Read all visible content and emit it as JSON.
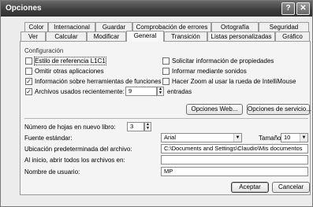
{
  "window": {
    "title": "Opciones",
    "help_label": "?",
    "close_label": "✕"
  },
  "tabs_row1": [
    "Color",
    "Internacional",
    "Guardar",
    "Comprobación de errores",
    "Ortografía",
    "Seguridad"
  ],
  "tabs_row2": [
    "Ver",
    "Calcular",
    "Modificar",
    "General",
    "Transición",
    "Listas personalizadas",
    "Gráfico"
  ],
  "active_tab": "General",
  "config": {
    "group_label": "Configuración",
    "left_options": [
      {
        "label": "Estilo de referencia L1C1",
        "checked": false
      },
      {
        "label": "Omitir otras aplicaciones",
        "checked": false
      },
      {
        "label": "Información sobre herramientas de funciones",
        "checked": true
      },
      {
        "label": "Archivos usados recientemente:",
        "checked": true
      }
    ],
    "right_options": [
      {
        "label": "Solicitar información de propiedades",
        "checked": false
      },
      {
        "label": "Informar mediante sonidos",
        "checked": false
      },
      {
        "label": "Hacer Zoom al usar la rueda de IntelliMouse",
        "checked": false
      }
    ],
    "recent_files_value": "9",
    "recent_files_suffix": "entradas",
    "web_options_button": "Opciones Web...",
    "service_options_button": "Opciones de servicio..."
  },
  "book": {
    "sheets_label": "Número de hojas en nuevo libro:",
    "sheets_value": "3",
    "font_label": "Fuente estándar:",
    "font_value": "Arial",
    "size_label": "Tamaño:",
    "size_value": "10",
    "default_location_label": "Ubicación predeterminada del archivo:",
    "default_location_value": "C:\\Documents and Settings\\Claudio\\Mis documentos",
    "startup_label": "Al inicio, abrir todos los archivos en:",
    "startup_value": "",
    "username_label": "Nombre de usuario:",
    "username_value": "MP"
  },
  "footer": {
    "accept_button": "Aceptar",
    "cancel_button": "Cancelar"
  }
}
